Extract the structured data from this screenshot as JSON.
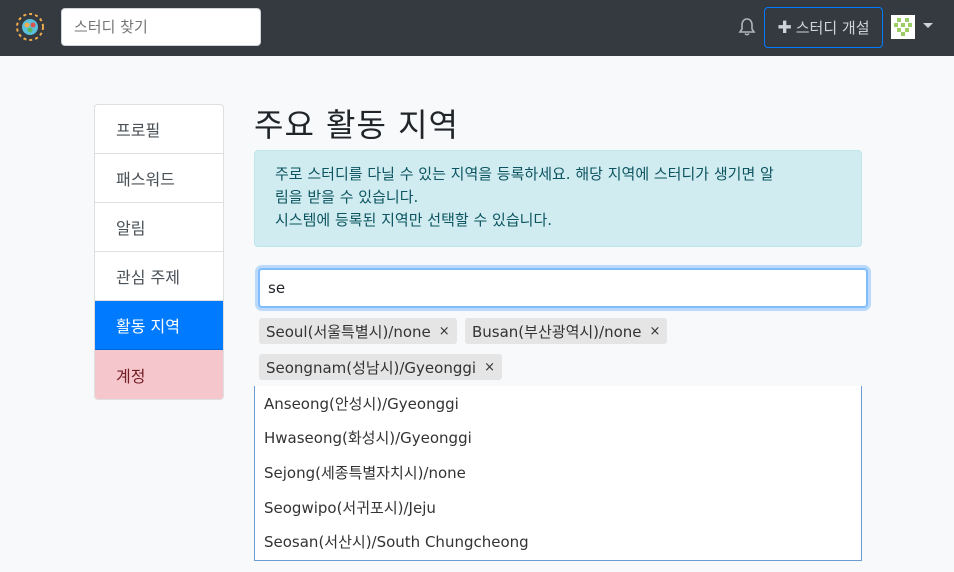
{
  "navbar": {
    "search_placeholder": "스터디 찾기",
    "create_label": "스터디 개설",
    "icons": [
      "logo-icon",
      "bell-icon",
      "plus-icon",
      "avatar-icon",
      "caret-down-icon"
    ]
  },
  "sidebar": {
    "items": [
      {
        "label": "프로필"
      },
      {
        "label": "패스워드"
      },
      {
        "label": "알림"
      },
      {
        "label": "관심 주제"
      },
      {
        "label": "활동 지역"
      },
      {
        "label": "계정"
      }
    ]
  },
  "main": {
    "title": "주요 활동 지역",
    "alert_line1": "주로 스터디를 다닐 수 있는 지역을 등록하세요. 해당 지역에 스터디가 생기면 알",
    "alert_line2": "림을 받을 수 있습니다.",
    "alert_line3": "시스템에 등록된 지역만 선택할 수 있습니다.",
    "input_value": "se",
    "tags": [
      {
        "label": "Seoul(서울특별시)/none"
      },
      {
        "label": "Busan(부산광역시)/none"
      },
      {
        "label": "Seongnam(성남시)/Gyeonggi"
      }
    ],
    "suggestions": [
      "Anseong(안성시)/Gyeonggi",
      "Hwaseong(화성시)/Gyeonggi",
      "Sejong(세종특별자치시)/none",
      "Seogwipo(서귀포시)/Jeju",
      "Seosan(서산시)/South Chungcheong"
    ]
  },
  "colors": {
    "navbar": "#343a40",
    "primary": "#007bff",
    "alert_bg": "#d1ecf1",
    "danger_bg": "#f5c6cb"
  }
}
